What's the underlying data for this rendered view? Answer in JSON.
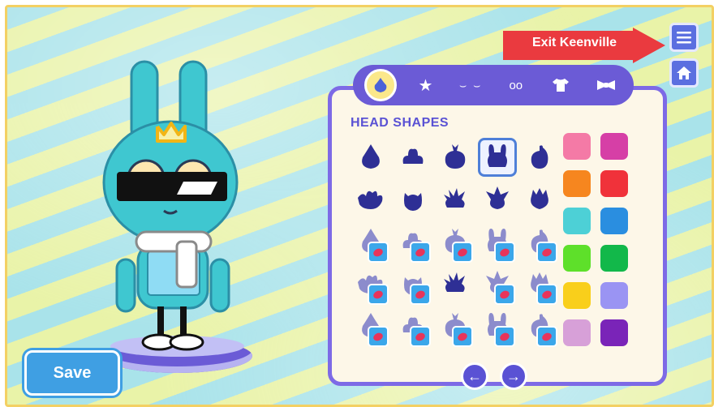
{
  "toolbar": {
    "exit_tooltip": "Exit Keenville",
    "menu_icon": "hamburger-menu-icon",
    "home_icon": "home-icon"
  },
  "save_label": "Save",
  "tabs": [
    {
      "icon": "head-shape-icon",
      "active": true
    },
    {
      "icon": "star-icon",
      "active": false
    },
    {
      "icon": "eyes-icon",
      "active": false
    },
    {
      "icon": "glasses-icon",
      "active": false
    },
    {
      "icon": "shirt-icon",
      "active": false
    },
    {
      "icon": "bowtie-icon",
      "active": false
    }
  ],
  "section_title": "HEAD SHAPES",
  "head_shapes": [
    {
      "icon": "onion-head-icon",
      "locked": false,
      "selected": false
    },
    {
      "icon": "blob-head-icon",
      "locked": false,
      "selected": false
    },
    {
      "icon": "tomato-head-icon",
      "locked": false,
      "selected": false
    },
    {
      "icon": "bunny-head-icon",
      "locked": false,
      "selected": true
    },
    {
      "icon": "small-sprout-head-icon",
      "locked": false,
      "selected": false
    },
    {
      "icon": "splat-head-icon",
      "locked": false,
      "selected": false
    },
    {
      "icon": "cat-head-icon",
      "locked": false,
      "selected": false
    },
    {
      "icon": "spiky-head-icon",
      "locked": false,
      "selected": false
    },
    {
      "icon": "star-head-icon",
      "locked": false,
      "selected": false
    },
    {
      "icon": "crown-head-icon",
      "locked": false,
      "selected": false
    },
    {
      "icon": "leaf-head-icon",
      "locked": true,
      "selected": false
    },
    {
      "icon": "fox-head-icon",
      "locked": true,
      "selected": false
    },
    {
      "icon": "cloud-head-icon",
      "locked": true,
      "selected": false
    },
    {
      "icon": "antenna-head-icon",
      "locked": true,
      "selected": false
    },
    {
      "icon": "bird-head-icon",
      "locked": true,
      "selected": false
    },
    {
      "icon": "puff-head-icon",
      "locked": true,
      "selected": false
    },
    {
      "icon": "tuft-head-icon",
      "locked": true,
      "selected": false
    },
    {
      "icon": "anemone-head-icon",
      "locked": false,
      "selected": false
    },
    {
      "icon": "swirl-head-icon",
      "locked": true,
      "selected": false
    },
    {
      "icon": "flame-head-icon",
      "locked": true,
      "selected": false
    },
    {
      "icon": "horn-head-icon",
      "locked": true,
      "selected": false
    },
    {
      "icon": "moon-head-icon",
      "locked": true,
      "selected": false
    },
    {
      "icon": "peak-head-icon",
      "locked": true,
      "selected": false
    },
    {
      "icon": "cross-head-icon",
      "locked": true,
      "selected": false
    },
    {
      "icon": "sun-head-icon",
      "locked": true,
      "selected": false
    }
  ],
  "colors": [
    "#f47aa6",
    "#d63fa6",
    "#f6861f",
    "#f0323a",
    "#4dd0d6",
    "#2a8ee0",
    "#5ee02a",
    "#12b84a",
    "#f9cf1b",
    "#9a94f3",
    "#d7a0d8",
    "#7a24b8"
  ],
  "pager": {
    "prev_icon": "arrow-left-icon",
    "next_icon": "arrow-right-icon"
  }
}
